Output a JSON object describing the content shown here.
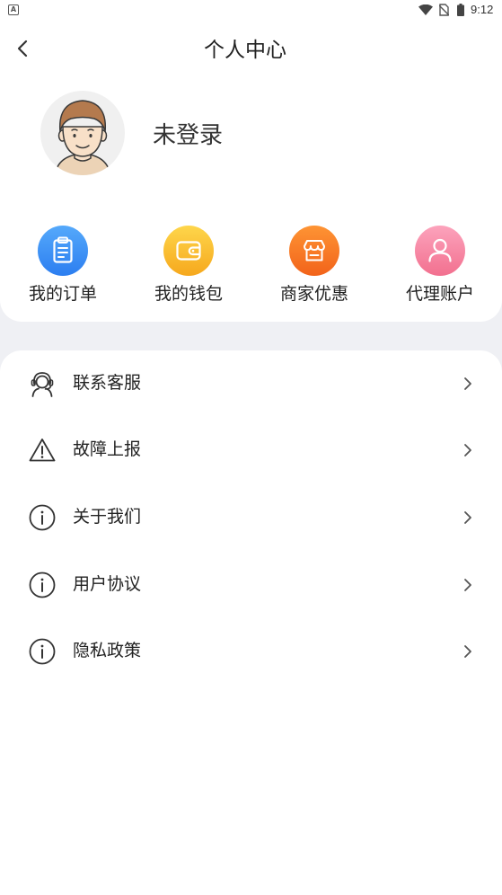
{
  "status_bar": {
    "notification_badge": "A",
    "notification_icon": "a-notification-icon",
    "wifi_icon": "wifi-icon",
    "sim_icon": "no-sim-icon",
    "battery_icon": "battery-icon",
    "time": "9:12"
  },
  "header": {
    "back_icon": "chevron-left-icon",
    "title": "个人中心"
  },
  "profile": {
    "avatar_icon": "avatar-icon",
    "name": "未登录"
  },
  "quick_actions": [
    {
      "label": "我的订单",
      "icon": "clipboard-icon",
      "colors": [
        "#55a9fb",
        "#2c7ef0"
      ]
    },
    {
      "label": "我的钱包",
      "icon": "wallet-icon",
      "colors": [
        "#fed64b",
        "#f6a81d"
      ]
    },
    {
      "label": "商家优惠",
      "icon": "store-icon",
      "colors": [
        "#fe9434",
        "#f2631a"
      ]
    },
    {
      "label": "代理账户",
      "icon": "user-icon",
      "colors": [
        "#fca3bc",
        "#f2708f"
      ]
    }
  ],
  "menu": [
    {
      "label": "联系客服",
      "icon": "customer-service-icon"
    },
    {
      "label": "故障上报",
      "icon": "warning-icon"
    },
    {
      "label": "关于我们",
      "icon": "info-icon"
    },
    {
      "label": "用户协议",
      "icon": "info-icon"
    },
    {
      "label": "隐私政策",
      "icon": "info-icon"
    }
  ],
  "colors": {
    "page_background": "#eff0f4",
    "card_background": "#ffffff",
    "text": "#222222",
    "icon_stroke": "#333333"
  }
}
